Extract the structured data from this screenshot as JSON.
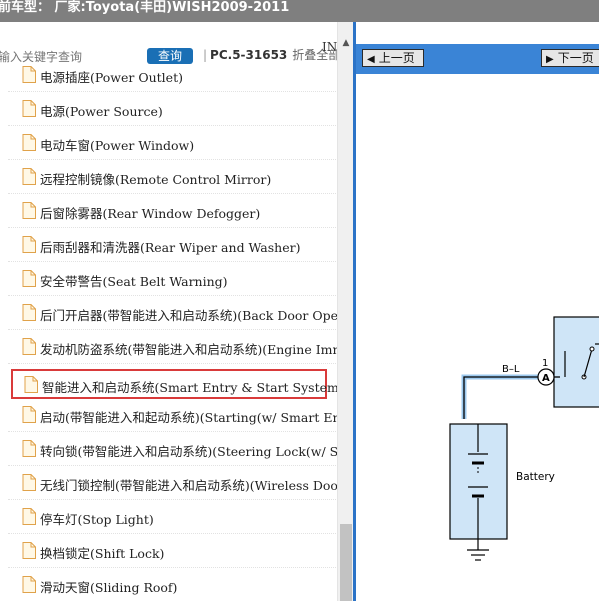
{
  "header": {
    "title": "前车型：  厂家:Toyota(丰田)WISH2009-2011"
  },
  "search": {
    "placeholder": "输入关键字查询",
    "button": "查询"
  },
  "pc_info": {
    "separator": "|",
    "code": "PC.5-31653",
    "collapse_all": "折叠全部",
    "extra": "IN"
  },
  "tree": {
    "items": [
      {
        "label": "电源插座(Power Outlet)"
      },
      {
        "label": "电源(Power Source)"
      },
      {
        "label": "电动车窗(Power Window)"
      },
      {
        "label": "远程控制镜像(Remote Control Mirror)"
      },
      {
        "label": "后窗除雾器(Rear Window Defogger)"
      },
      {
        "label": "后雨刮器和清洗器(Rear Wiper and Washer)"
      },
      {
        "label": "安全带警告(Seat Belt Warning)"
      },
      {
        "label": "后门开启器(带智能进入和启动系统)(Back Door Opener"
      },
      {
        "label": "发动机防盗系统(带智能进入和启动系统)(Engine Immobil"
      },
      {
        "label": "智能进入和启动系统(Smart Entry & Start System )",
        "selected": true
      },
      {
        "label": "启动(带智能进入和起动系统)(Starting(w/ Smart Entry"
      },
      {
        "label": "转向锁(带智能进入和启动系统)(Steering Lock(w/ Smar"
      },
      {
        "label": "无线门锁控制(带智能进入和启动系统)(Wireless Door"
      },
      {
        "label": "停车灯(Stop Light)"
      },
      {
        "label": "换档锁定(Shift Lock)"
      },
      {
        "label": "滑动天窗(Sliding Roof)"
      }
    ]
  },
  "viewer": {
    "prev": "上一页",
    "next": "下一页",
    "diagram": {
      "wire_label": "B–L",
      "pin_number": "1",
      "connector": "A",
      "battery_label": "Battery"
    }
  },
  "colors": {
    "accent": "#1a6fb5",
    "toolbar": "#3a84d6",
    "highlight": "#d93a3a",
    "diagram_fill": "#cfe5f7"
  }
}
